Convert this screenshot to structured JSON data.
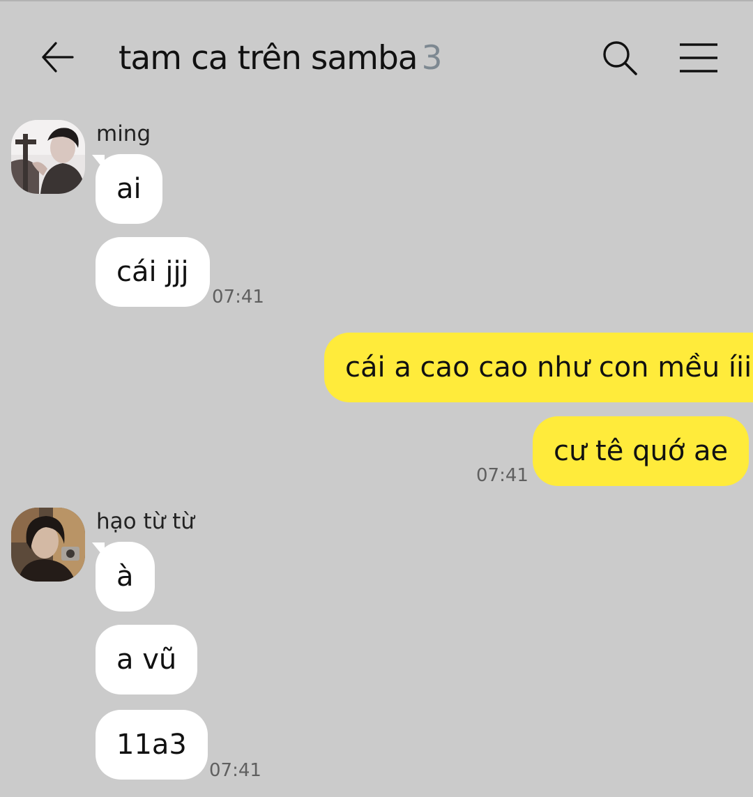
{
  "header": {
    "back_icon": "arrow-left-icon",
    "title": "tam ca trên samba",
    "member_count": "3",
    "search_icon": "search-icon",
    "menu_icon": "hamburger-menu-icon"
  },
  "colors": {
    "background": "#cbcbcb",
    "incoming_bubble": "#ffffff",
    "outgoing_bubble": "#ffeb3b",
    "member_count": "#7d8891"
  },
  "messages": {
    "group1": {
      "sender": "ming",
      "bubbles": [
        "ai",
        "cái jjj"
      ],
      "time": "07:41"
    },
    "group2": {
      "bubbles": [
        "cái a cao cao như con mều íiii",
        "cư tê quớ ae"
      ],
      "time": "07:41"
    },
    "group3": {
      "sender": "hạo từ từ",
      "bubbles": [
        "à",
        "a vũ",
        "11a3"
      ],
      "time": "07:41"
    }
  }
}
